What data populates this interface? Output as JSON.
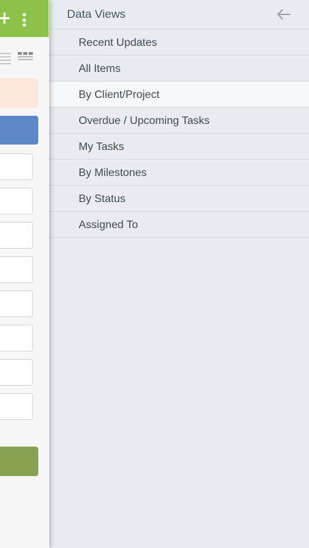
{
  "panel": {
    "title": "Data Views",
    "items": [
      {
        "label": "Recent Updates",
        "active": false
      },
      {
        "label": "All Items",
        "active": false
      },
      {
        "label": "By Client/Project",
        "active": true
      },
      {
        "label": "Overdue / Upcoming Tasks",
        "active": false
      },
      {
        "label": "My Tasks",
        "active": false
      },
      {
        "label": "By Milestones",
        "active": false
      },
      {
        "label": "By Status",
        "active": false
      },
      {
        "label": "Assigned To",
        "active": false
      }
    ]
  },
  "icons": {
    "back": "arrow-left-icon",
    "add": "plus-icon",
    "more": "more-vertical-icon",
    "list_view": "list-view-icon",
    "grid_view": "grid-view-icon"
  },
  "colors": {
    "top_bar": "#8bc34a",
    "primary_button": "#5c88c4",
    "submit_button": "#87a150",
    "notice_box": "#fde9dc",
    "panel_background": "#e9edef",
    "active_item": "#f7f8f9"
  }
}
